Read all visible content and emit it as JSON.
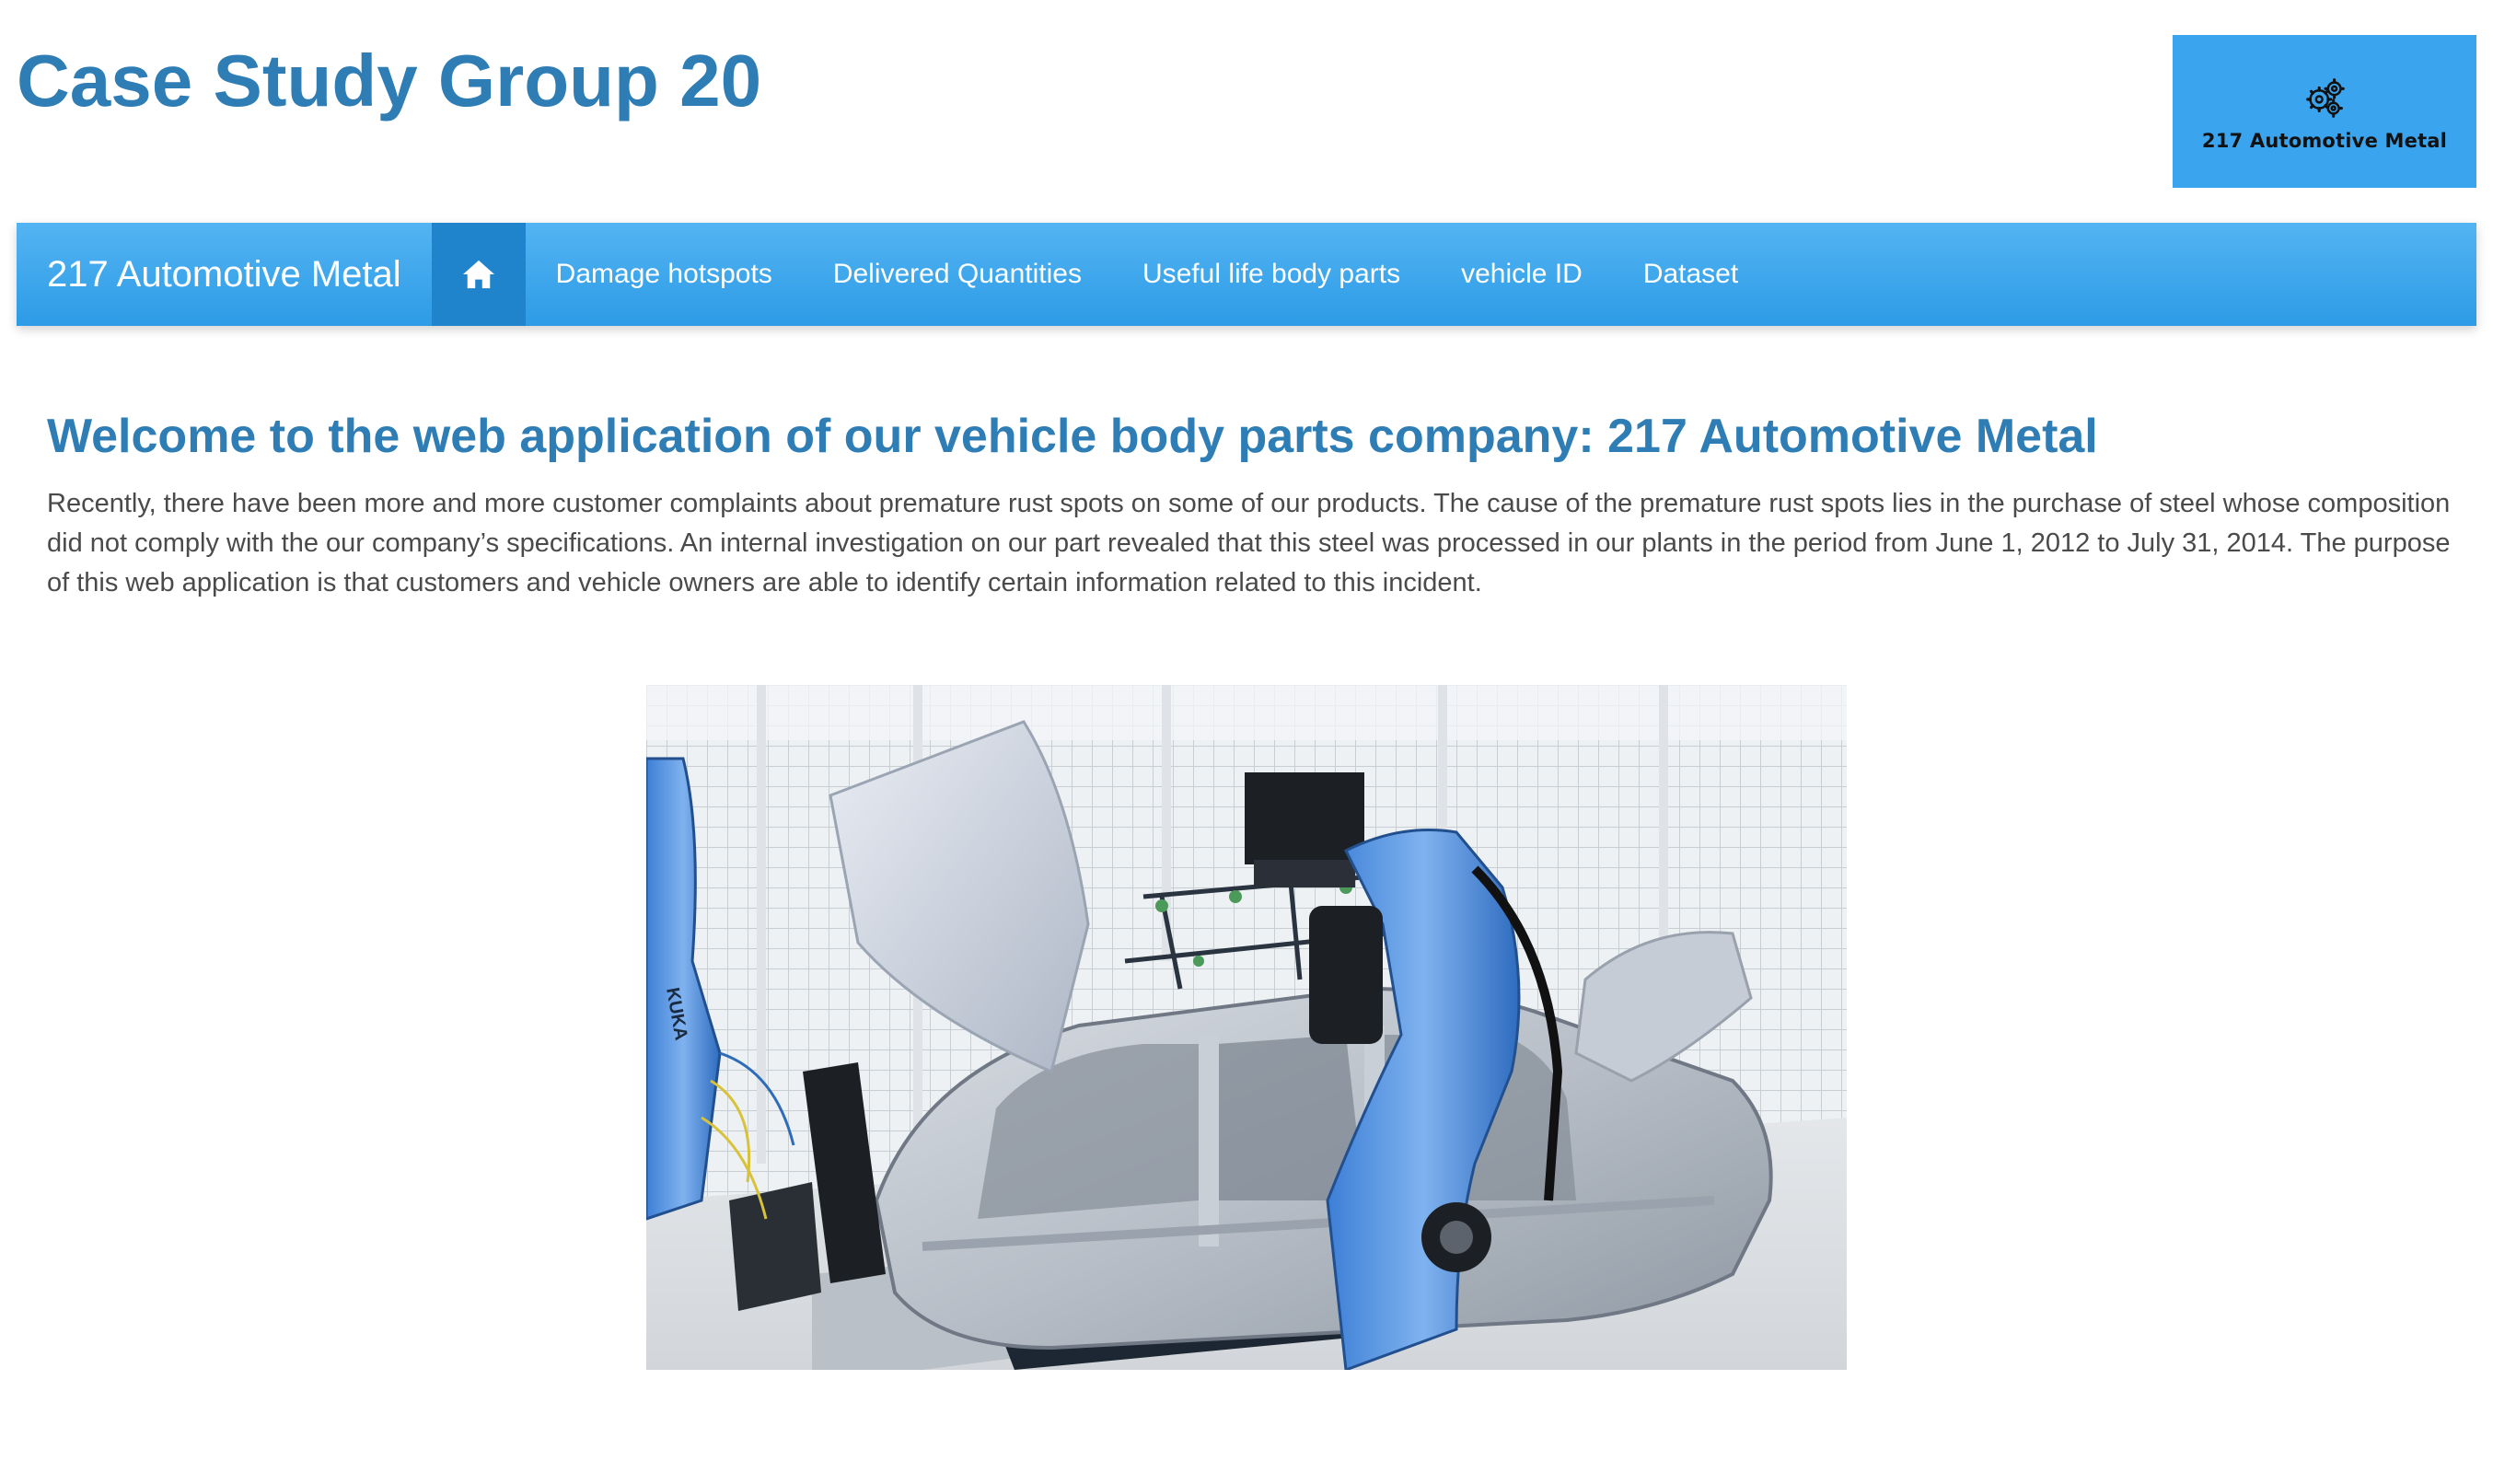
{
  "header": {
    "site_title": "Case Study Group 20",
    "logo_text": "217 Automotive Metal"
  },
  "navbar": {
    "brand": "217 Automotive Metal",
    "home_icon": "home-icon",
    "items": [
      {
        "label": "Damage hotspots"
      },
      {
        "label": "Delivered Quantities"
      },
      {
        "label": "Useful life body parts"
      },
      {
        "label": "vehicle ID"
      },
      {
        "label": "Dataset"
      }
    ]
  },
  "main": {
    "heading": "Welcome to the web application of our vehicle body parts company: 217 Automotive Metal",
    "intro": "Recently, there have been more and more customer complaints about premature rust spots on some of our products. The cause of the premature rust spots lies in the purchase of steel whose composition did not comply with the our company’s specifications. An internal investigation on our part revealed that this steel was processed in our plants in the period from June 1, 2012 to July 31, 2014. The purpose of this web application is that customers and vehicle owners are able to identify certain information related to this incident.",
    "image_text": {
      "robot_label": "KUKA"
    }
  },
  "colors": {
    "title": "#2e7db5",
    "navbar": "#3aa5ee",
    "navbar_active": "#1f84cc",
    "logo_bg": "#3aa5ee",
    "text": "#4a4a4a"
  }
}
